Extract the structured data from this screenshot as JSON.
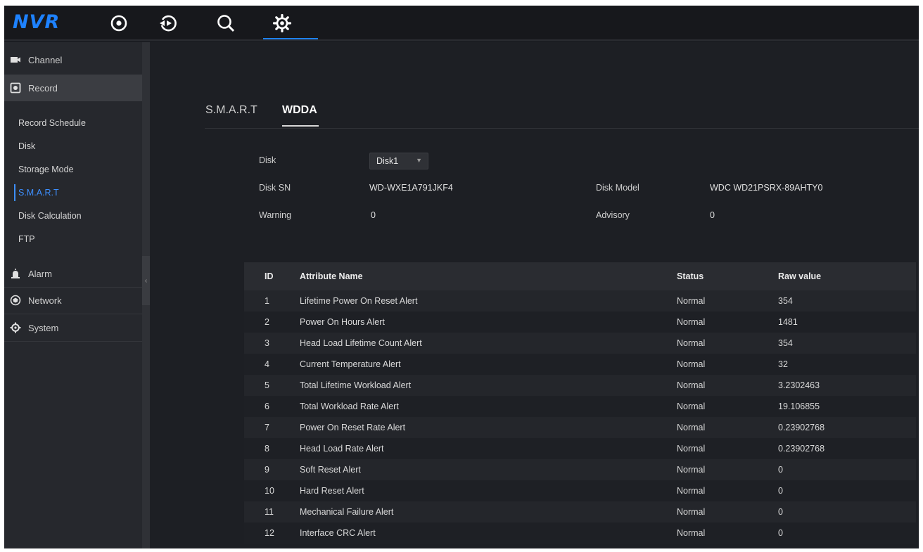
{
  "app": {
    "logo": "NVR"
  },
  "topnav": [
    {
      "name": "live-view-icon",
      "label": ""
    },
    {
      "name": "playback-icon",
      "label": ""
    },
    {
      "name": "search-icon",
      "label": ""
    },
    {
      "name": "settings-icon",
      "label": ""
    }
  ],
  "sidebar": {
    "channel": "Channel",
    "record": "Record",
    "sub": [
      "Record Schedule",
      "Disk",
      "Storage Mode",
      "S.M.A.R.T",
      "Disk Calculation",
      "FTP"
    ],
    "alarm": "Alarm",
    "network": "Network",
    "system": "System"
  },
  "tabs": {
    "smart": "S.M.A.R.T",
    "wdda": "WDDA"
  },
  "form": {
    "disk_label": "Disk",
    "disk_value": "Disk1",
    "disk_sn_label": "Disk SN",
    "disk_sn_value": "WD-WXE1A791JKF4",
    "disk_model_label": "Disk Model",
    "disk_model_value": "WDC WD21PSRX-89AHTY0",
    "warning_label": "Warning",
    "warning_value": "0",
    "advisory_label": "Advisory",
    "advisory_value": "0"
  },
  "table": {
    "headers": {
      "id": "ID",
      "name": "Attribute Name",
      "status": "Status",
      "raw": "Raw value"
    },
    "rows": [
      {
        "id": "1",
        "name": "Lifetime Power On Reset Alert",
        "status": "Normal",
        "raw": "354"
      },
      {
        "id": "2",
        "name": "Power On Hours Alert",
        "status": "Normal",
        "raw": "1481"
      },
      {
        "id": "3",
        "name": "Head Load Lifetime Count Alert",
        "status": "Normal",
        "raw": "354"
      },
      {
        "id": "4",
        "name": "Current Temperature Alert",
        "status": "Normal",
        "raw": "32"
      },
      {
        "id": "5",
        "name": "Total Lifetime Workload Alert",
        "status": "Normal",
        "raw": "3.2302463"
      },
      {
        "id": "6",
        "name": "Total Workload Rate Alert",
        "status": "Normal",
        "raw": "19.106855"
      },
      {
        "id": "7",
        "name": "Power On Reset Rate Alert",
        "status": "Normal",
        "raw": "0.23902768"
      },
      {
        "id": "8",
        "name": "Head Load Rate Alert",
        "status": "Normal",
        "raw": "0.23902768"
      },
      {
        "id": "9",
        "name": "Soft Reset Alert",
        "status": "Normal",
        "raw": "0"
      },
      {
        "id": "10",
        "name": "Hard Reset Alert",
        "status": "Normal",
        "raw": "0"
      },
      {
        "id": "11",
        "name": "Mechanical Failure Alert",
        "status": "Normal",
        "raw": "0"
      },
      {
        "id": "12",
        "name": "Interface CRC Alert",
        "status": "Normal",
        "raw": "0"
      }
    ]
  }
}
